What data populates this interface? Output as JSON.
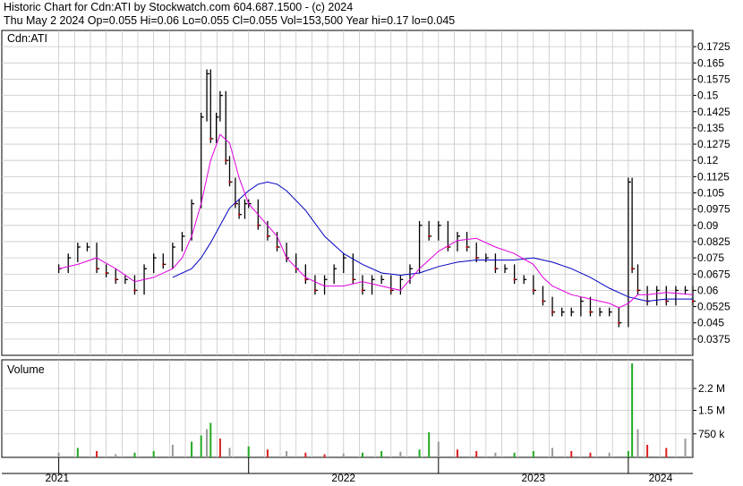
{
  "header": {
    "line1": "Historic Chart for Cdn:ATI by Stockwatch.com 604.687.1500 - (c) 2024",
    "line2": "Thu May  2 2024  Op=0.055  Hi=0.06  Lo=0.055  Cl=0.055  Vol=153,500  Year hi=0.17  lo=0.045"
  },
  "colors": {
    "price_bar": "#000000",
    "down_tick": "#cc0000",
    "ma_short": "#e000e0",
    "ma_long": "#0000c0",
    "volume_up": "#22aa22",
    "volume_down": "#dd2222",
    "volume_flat": "#999999",
    "grid": "#c8c8c8"
  },
  "chart_data": [
    {
      "type": "line",
      "title": "Cdn:ATI",
      "y_ticks": [
        "0.1725",
        "0.165",
        "0.1575",
        "0.15",
        "0.1425",
        "0.135",
        "0.1275",
        "0.12",
        "0.1125",
        "0.105",
        "0.0975",
        "0.09",
        "0.0825",
        "0.075",
        "0.0675",
        "0.06",
        "0.0525",
        "0.045",
        "0.0375"
      ],
      "ylim": [
        0.03,
        0.18
      ],
      "x_labels": [
        "2021",
        "2022",
        "2023",
        "2024"
      ],
      "series": [
        {
          "name": "",
          "kind": "price",
          "x": [
            2021.0,
            2021.05,
            2021.1,
            2021.15,
            2021.2,
            2021.25,
            2021.3,
            2021.35,
            2021.4,
            2021.45,
            2021.5,
            2021.55,
            2021.6,
            2021.65,
            2021.7,
            2021.75,
            2021.78,
            2021.8,
            2021.83,
            2021.85,
            2021.88,
            2021.9,
            2021.93,
            2021.95,
            2021.98,
            2022.0,
            2022.05,
            2022.1,
            2022.15,
            2022.2,
            2022.25,
            2022.3,
            2022.35,
            2022.4,
            2022.45,
            2022.5,
            2022.55,
            2022.6,
            2022.65,
            2022.7,
            2022.75,
            2022.8,
            2022.85,
            2022.9,
            2022.95,
            2023.0,
            2023.05,
            2023.1,
            2023.15,
            2023.2,
            2023.25,
            2023.3,
            2023.35,
            2023.4,
            2023.45,
            2023.5,
            2023.55,
            2023.6,
            2023.65,
            2023.7,
            2023.75,
            2023.8,
            2023.85,
            2023.9,
            2023.95,
            2024.0,
            2024.02,
            2024.05,
            2024.1,
            2024.15,
            2024.2,
            2024.25,
            2024.3,
            2024.34
          ],
          "y": [
            0.07,
            0.075,
            0.08,
            0.08,
            0.07,
            0.068,
            0.065,
            0.065,
            0.06,
            0.07,
            0.075,
            0.072,
            0.08,
            0.085,
            0.1,
            0.14,
            0.16,
            0.13,
            0.14,
            0.15,
            0.12,
            0.11,
            0.1,
            0.095,
            0.1,
            0.1,
            0.09,
            0.085,
            0.08,
            0.075,
            0.07,
            0.065,
            0.06,
            0.065,
            0.07,
            0.075,
            0.065,
            0.06,
            0.065,
            0.065,
            0.06,
            0.065,
            0.07,
            0.09,
            0.085,
            0.09,
            0.08,
            0.085,
            0.08,
            0.075,
            0.075,
            0.07,
            0.07,
            0.065,
            0.065,
            0.06,
            0.055,
            0.05,
            0.05,
            0.05,
            0.055,
            0.05,
            0.05,
            0.05,
            0.045,
            0.11,
            0.07,
            0.06,
            0.055,
            0.06,
            0.055,
            0.06,
            0.06,
            0.055
          ]
        },
        {
          "name": "",
          "kind": "ma_short",
          "x": [
            2021.0,
            2021.1,
            2021.2,
            2021.3,
            2021.4,
            2021.5,
            2021.6,
            2021.65,
            2021.7,
            2021.75,
            2021.8,
            2021.85,
            2021.9,
            2021.95,
            2022.0,
            2022.05,
            2022.1,
            2022.15,
            2022.2,
            2022.3,
            2022.4,
            2022.5,
            2022.6,
            2022.7,
            2022.8,
            2022.9,
            2023.0,
            2023.1,
            2023.2,
            2023.3,
            2023.4,
            2023.5,
            2023.55,
            2023.6,
            2023.7,
            2023.8,
            2023.9,
            2023.95,
            2024.0,
            2024.05,
            2024.1,
            2024.2,
            2024.34
          ],
          "y": [
            0.07,
            0.072,
            0.075,
            0.07,
            0.064,
            0.066,
            0.07,
            0.075,
            0.085,
            0.1,
            0.12,
            0.132,
            0.128,
            0.112,
            0.1,
            0.095,
            0.09,
            0.085,
            0.075,
            0.066,
            0.062,
            0.062,
            0.064,
            0.062,
            0.06,
            0.07,
            0.078,
            0.083,
            0.084,
            0.08,
            0.077,
            0.072,
            0.066,
            0.062,
            0.058,
            0.056,
            0.054,
            0.052,
            0.054,
            0.058,
            0.058,
            0.059,
            0.058
          ]
        },
        {
          "name": "",
          "kind": "ma_long",
          "x": [
            2021.6,
            2021.7,
            2021.75,
            2021.8,
            2021.85,
            2021.9,
            2022.0,
            2022.05,
            2022.1,
            2022.15,
            2022.2,
            2022.3,
            2022.4,
            2022.5,
            2022.6,
            2022.7,
            2022.8,
            2022.9,
            2023.0,
            2023.1,
            2023.2,
            2023.3,
            2023.4,
            2023.5,
            2023.6,
            2023.7,
            2023.8,
            2023.9,
            2024.0,
            2024.05,
            2024.1,
            2024.2,
            2024.34
          ],
          "y": [
            0.066,
            0.07,
            0.075,
            0.082,
            0.09,
            0.098,
            0.106,
            0.109,
            0.11,
            0.109,
            0.106,
            0.097,
            0.085,
            0.077,
            0.072,
            0.068,
            0.067,
            0.068,
            0.071,
            0.073,
            0.074,
            0.074,
            0.074,
            0.075,
            0.073,
            0.07,
            0.066,
            0.061,
            0.057,
            0.056,
            0.055,
            0.056,
            0.056
          ]
        }
      ]
    },
    {
      "type": "bar",
      "title": "Volume",
      "y_ticks": [
        "2.2 M",
        "1.5 M",
        "750 k"
      ],
      "ylim": [
        0,
        3000000
      ],
      "x_labels": [
        "2021",
        "2022",
        "2023",
        "2024"
      ],
      "x": [
        2021.0,
        2021.1,
        2021.2,
        2021.3,
        2021.4,
        2021.5,
        2021.6,
        2021.7,
        2021.75,
        2021.78,
        2021.8,
        2021.85,
        2021.9,
        2022.0,
        2022.1,
        2022.2,
        2022.3,
        2022.4,
        2022.5,
        2022.6,
        2022.7,
        2022.8,
        2022.9,
        2022.95,
        2023.0,
        2023.1,
        2023.2,
        2023.3,
        2023.4,
        2023.5,
        2023.6,
        2023.7,
        2023.8,
        2023.9,
        2024.0,
        2024.02,
        2024.05,
        2024.1,
        2024.2,
        2024.3
      ],
      "values": [
        150000,
        300000,
        200000,
        100000,
        150000,
        200000,
        400000,
        500000,
        700000,
        900000,
        1100000,
        600000,
        300000,
        350000,
        250000,
        200000,
        150000,
        100000,
        120000,
        150000,
        200000,
        180000,
        250000,
        800000,
        500000,
        250000,
        200000,
        150000,
        150000,
        200000,
        300000,
        200000,
        150000,
        150000,
        200000,
        3000000,
        900000,
        400000,
        300000,
        600000
      ]
    }
  ]
}
